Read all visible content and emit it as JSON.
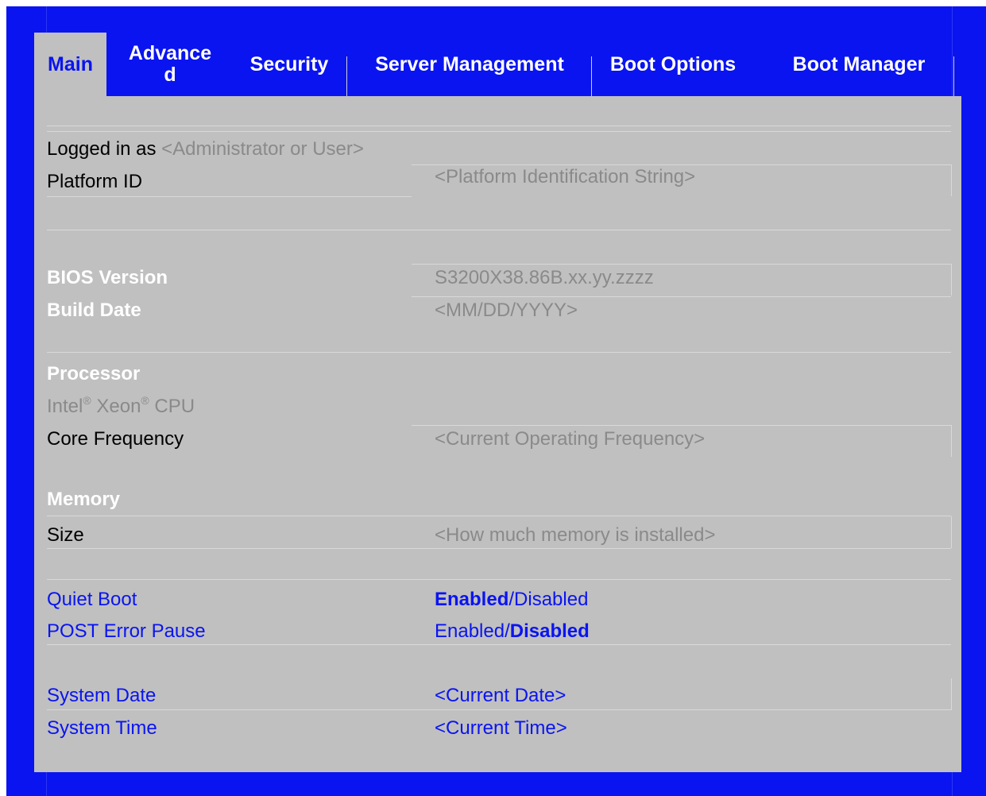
{
  "colors": {
    "frame": "#0a14f0",
    "panel": "#c0c0c0",
    "accent": "#0a14f0",
    "heading": "#ffffff",
    "info_value": "#8a8a8a"
  },
  "tabs": [
    {
      "label": "Main",
      "active": true
    },
    {
      "label": "Advance\nd",
      "active": false
    },
    {
      "label": "Security",
      "active": false
    },
    {
      "label": "Server Management",
      "active": false
    },
    {
      "label": "Boot Options",
      "active": false
    },
    {
      "label": "Boot Manager",
      "active": false
    }
  ],
  "main": {
    "logged_in": {
      "label": "Logged in as",
      "value": "<Administrator or User>"
    },
    "platform_id": {
      "label": "Platform ID",
      "value": "<Platform Identification String>"
    },
    "bios_version": {
      "label": "BIOS Version",
      "value": "S3200X38.86B.xx.yy.zzzz"
    },
    "build_date": {
      "label": "Build Date",
      "value": "<MM/DD/YYYY>"
    },
    "processor": {
      "heading": "Processor",
      "cpu_part1": "Intel",
      "reg_mark_1": "®",
      "cpu_part2": " Xeon",
      "reg_mark_2": "®",
      "cpu_part3": " CPU"
    },
    "core_frequency": {
      "label": "Core Frequency",
      "value": "<Current Operating Frequency>"
    },
    "memory": {
      "heading": "Memory",
      "size_label": "Size",
      "size_value": "<How much memory is installed>"
    },
    "quiet_boot": {
      "label": "Quiet Boot",
      "option_enabled": "Enabled",
      "separator": "/",
      "option_disabled": "Disabled",
      "selected": "Enabled"
    },
    "post_error_pause": {
      "label": "POST Error Pause",
      "option_enabled": "Enabled",
      "separator": "/",
      "option_disabled": "Disabled",
      "selected": "Disabled"
    },
    "system_date": {
      "label": "System Date",
      "value": "<Current Date>"
    },
    "system_time": {
      "label": "System Time",
      "value": "<Current Time>"
    }
  }
}
